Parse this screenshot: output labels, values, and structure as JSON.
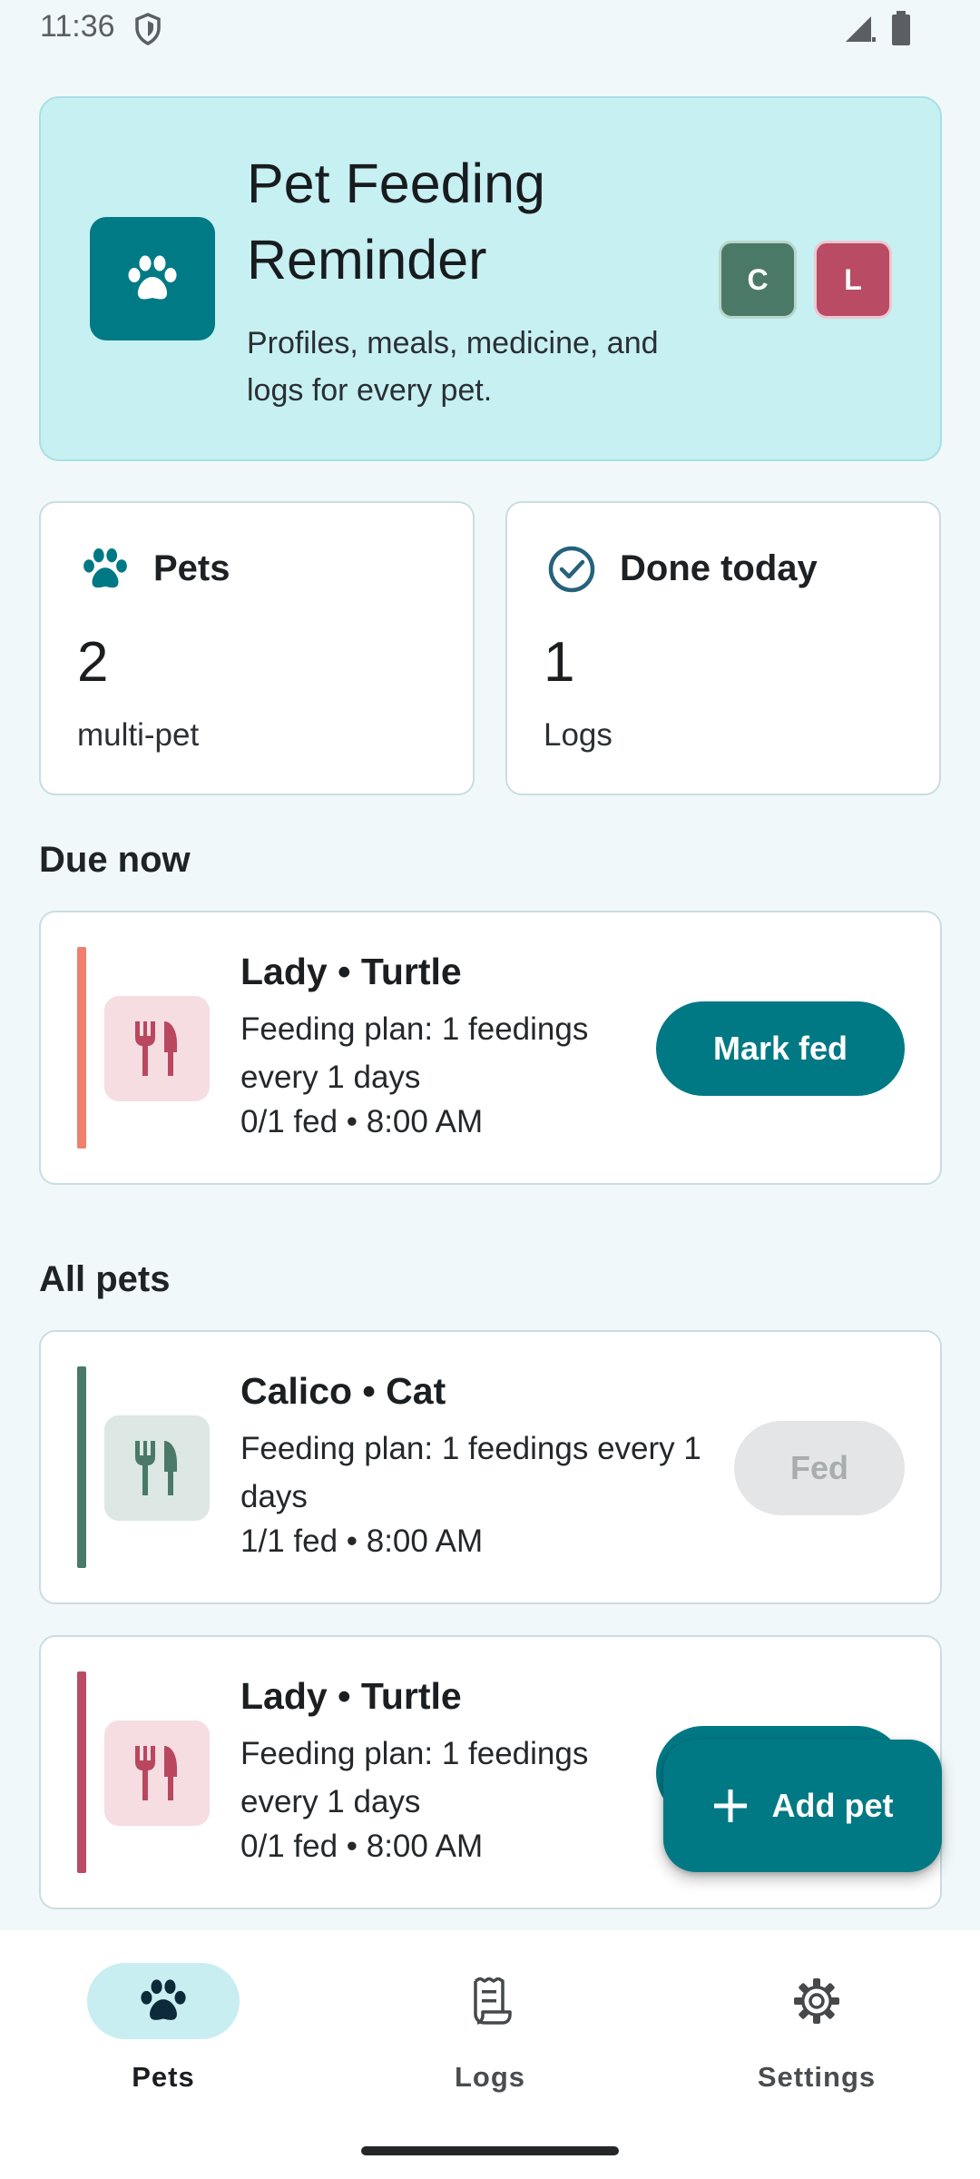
{
  "status_bar": {
    "time": "11:36"
  },
  "header": {
    "title": "Pet Feeding Reminder",
    "subtitle": "Profiles, meals, medicine, and logs for every pet.",
    "avatars": [
      {
        "initial": "C",
        "color": "#4a7a67"
      },
      {
        "initial": "L",
        "color": "#b94b64"
      }
    ]
  },
  "stats": {
    "pets": {
      "title": "Pets",
      "value": "2",
      "sub": "multi-pet"
    },
    "done": {
      "title": "Done today",
      "value": "1",
      "sub": "Logs"
    }
  },
  "sections": {
    "due_now": "Due now",
    "all_pets": "All pets"
  },
  "due_now_card": {
    "name": "Lady • Turtle",
    "plan": "Feeding plan: 1 feedings every 1 days",
    "status": "0/1 fed • 8:00 AM",
    "button": "Mark fed",
    "accent": "#f07f6e"
  },
  "all_pets": [
    {
      "name": "Calico • Cat",
      "plan": "Feeding plan: 1 feedings every 1 days",
      "status": "1/1 fed • 8:00 AM",
      "button": "Fed",
      "accent": "#4a7a67"
    },
    {
      "name": "Lady • Turtle",
      "plan": "Feeding plan: 1 feedings every 1 days",
      "status": "0/1 fed • 8:00 AM",
      "accent": "#b94b64"
    }
  ],
  "fab": {
    "label": "Add pet",
    "icon": "plus-icon"
  },
  "nav": {
    "items": [
      {
        "label": "Pets",
        "icon": "paw-icon",
        "active": true
      },
      {
        "label": "Logs",
        "icon": "receipt-icon",
        "active": false
      },
      {
        "label": "Settings",
        "icon": "gear-icon",
        "active": false
      }
    ]
  },
  "colors": {
    "primary": "#017985",
    "background": "#f1f8fa",
    "header_bg": "#c7f0f3"
  }
}
